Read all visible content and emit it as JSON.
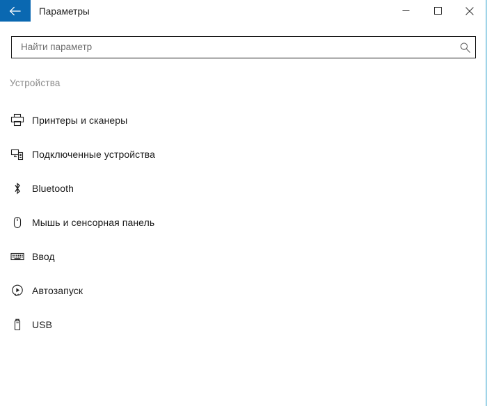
{
  "window": {
    "title": "Параметры",
    "back_icon": "arrow-left-icon",
    "accent_color": "#0a68b1",
    "controls": {
      "minimize_label": "—",
      "minimize_icon": "minimize-icon",
      "maximize_label": "☐",
      "maximize_icon": "maximize-icon",
      "close_label": "✕",
      "close_icon": "close-icon"
    }
  },
  "search": {
    "placeholder": "Найти параметр",
    "value": "",
    "icon": "search-icon"
  },
  "section": {
    "header": "Устройства",
    "items": [
      {
        "label": "Принтеры и сканеры",
        "icon": "printer-icon"
      },
      {
        "label": "Подключенные устройства",
        "icon": "connected-devices-icon"
      },
      {
        "label": "Bluetooth",
        "icon": "bluetooth-icon"
      },
      {
        "label": "Мышь и сенсорная панель",
        "icon": "mouse-icon"
      },
      {
        "label": "Ввод",
        "icon": "keyboard-icon"
      },
      {
        "label": "Автозапуск",
        "icon": "autoplay-icon"
      },
      {
        "label": "USB",
        "icon": "usb-icon"
      }
    ]
  }
}
